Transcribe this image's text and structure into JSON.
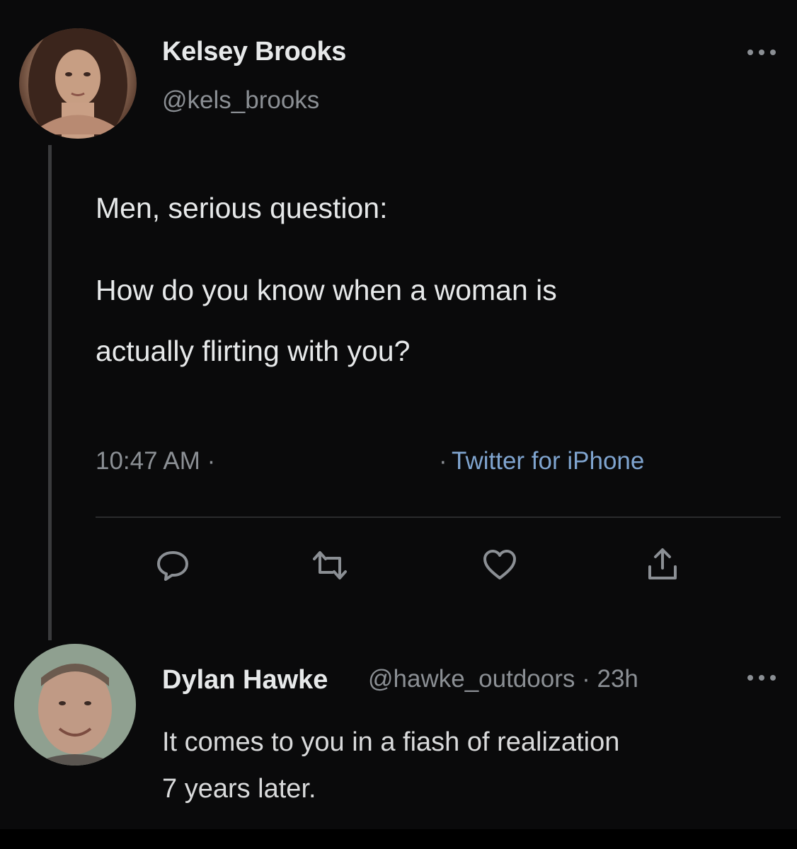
{
  "tweet": {
    "author": {
      "name": "Kelsey Brooks",
      "handle": "@kels_brooks"
    },
    "text_line_1": "Men, serious question:",
    "text_line_2": "How do you know when a woman is",
    "text_line_3": "actually flirting with you?",
    "time": "10:47 AM ·",
    "separator": "·",
    "source": "Twitter for iPhone",
    "actions": {
      "reply_icon": "reply-icon",
      "retweet_icon": "retweet-icon",
      "like_icon": "heart-icon",
      "share_icon": "share-icon"
    },
    "more_icon": "more-options-icon"
  },
  "reply": {
    "author": {
      "name": "Dylan Hawke",
      "handle_and_time": "@hawke_outdoors · 23h"
    },
    "text_line_1": "It comes to you in a fiash of realization",
    "text_line_2": "7 years later.",
    "more_icon": "more-options-icon"
  },
  "colors": {
    "background": "#0a0a0b",
    "primary_text": "#e7e9ea",
    "secondary_text": "#8b8f94",
    "link": "#7fa4cf"
  }
}
